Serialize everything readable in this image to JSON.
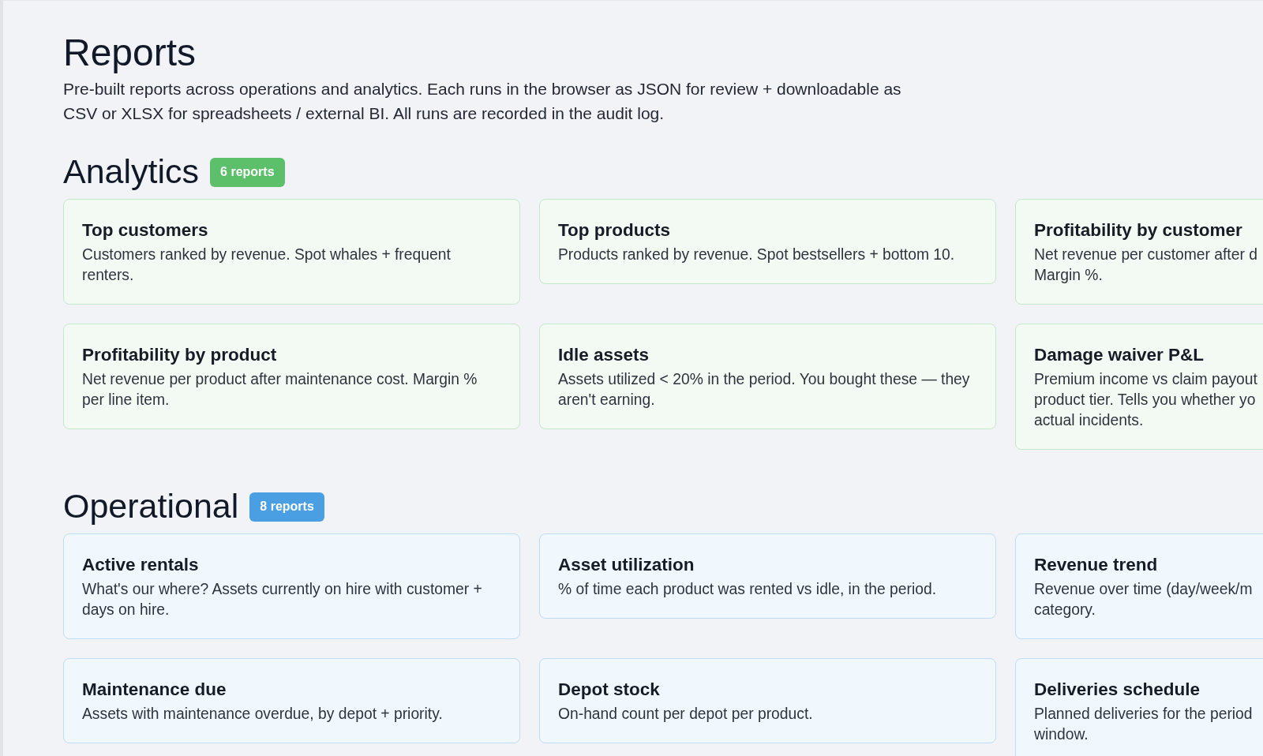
{
  "page": {
    "title": "Reports",
    "description": "Pre-built reports across operations and analytics. Each runs in the browser as JSON for review + downloadable as CSV or XLSX for spreadsheets / external BI. All runs are recorded in the audit log."
  },
  "sections": [
    {
      "title": "Analytics",
      "badge": "6 reports",
      "color": "#5cc06b",
      "reports": [
        {
          "title": "Top customers",
          "description": "Customers ranked by revenue. Spot whales + frequent renters."
        },
        {
          "title": "Top products",
          "description": "Products ranked by revenue. Spot bestsellers + bottom 10."
        },
        {
          "title": "Profitability by customer",
          "description": "Net revenue per customer after d\nMargin %."
        },
        {
          "title": "Profitability by product",
          "description": "Net revenue per product after maintenance cost. Margin % per line item."
        },
        {
          "title": "Idle assets",
          "description": "Assets utilized < 20% in the period. You bought these — they aren't earning."
        },
        {
          "title": "Damage waiver P&L",
          "description": "Premium income vs claim payout\nproduct tier. Tells you whether yo\nactual incidents."
        }
      ]
    },
    {
      "title": "Operational",
      "badge": "8 reports",
      "color": "#4a9fe2",
      "reports": [
        {
          "title": "Active rentals",
          "description": "What's our where? Assets currently on hire with customer + days on hire."
        },
        {
          "title": "Asset utilization",
          "description": "% of time each product was rented vs idle, in the period."
        },
        {
          "title": "Revenue trend",
          "description": "Revenue over time (day/week/m\ncategory."
        },
        {
          "title": "Maintenance due",
          "description": "Assets with maintenance overdue, by depot + priority."
        },
        {
          "title": "Depot stock",
          "description": "On-hand count per depot per product."
        },
        {
          "title": "Deliveries schedule",
          "description": "Planned deliveries for the period\nwindow."
        }
      ]
    }
  ]
}
